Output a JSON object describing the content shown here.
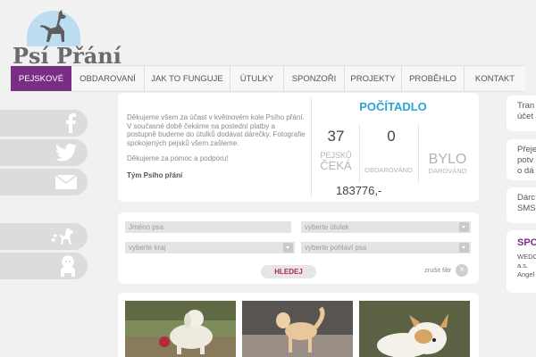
{
  "brand": {
    "name": "Psí Přání"
  },
  "nav": {
    "items": [
      {
        "label": "PEJSKOVÉ"
      },
      {
        "label": "OBDAROVANÍ"
      },
      {
        "label": "JAK TO FUNGUJE"
      },
      {
        "label": "ÚTULKY"
      },
      {
        "label": "SPONZOŘI"
      },
      {
        "label": "PROJEKTY"
      },
      {
        "label": "PROBĚHLO"
      },
      {
        "label": "KONTAKT"
      }
    ]
  },
  "social": {
    "icons": [
      "facebook-icon",
      "twitter-icon",
      "email-icon",
      "dog-filter-icon",
      "dog-icon"
    ]
  },
  "info": {
    "paragraph1": "Děkujeme všem za účast v květnovém kole Psího přání. V současné době čekáme na poslední platby a postupně budeme do útulků dodávat dárečky. Fotografie spokojených pejsků všem zašleme.",
    "paragraph2": "Děkujeme za pomoc a podporu!",
    "signature": "Tým Psího přání"
  },
  "counter": {
    "title": "POČÍTADLO",
    "waiting_value": "37",
    "waiting_label_1": "PEJSKŮ",
    "waiting_label_2": "ČEKÁ",
    "gifted_value": "0",
    "gifted_label": "OBDAROVÁNO",
    "was_value": "BYLO",
    "was_label": "DAROVÁNO",
    "total": "183776,-"
  },
  "filter": {
    "dog_name_placeholder": "Jméno psa",
    "shelter_placeholder": "vyberte útulek",
    "region_placeholder": "vyberte kraj",
    "gender_placeholder": "vyberte pohlaví psa",
    "search_label": "HLEDEJ",
    "cancel_label": "zrušit filtr",
    "cancel_symbol": "×"
  },
  "right": {
    "items": [
      {
        "line1": "Tran",
        "line2": "účet"
      },
      {
        "line1": "Přeje",
        "line2": "potv",
        "line3": "o dá"
      },
      {
        "line1": "Dárc",
        "line2": "SMS"
      },
      {
        "line1": "SPO",
        "line2": "WEDO",
        "line3": "a.s.",
        "line4": "Angel"
      }
    ]
  },
  "colors": {
    "accent_purple": "#7a2d85",
    "counter_blue": "#2aa4d8",
    "search_red": "#b4284f"
  }
}
